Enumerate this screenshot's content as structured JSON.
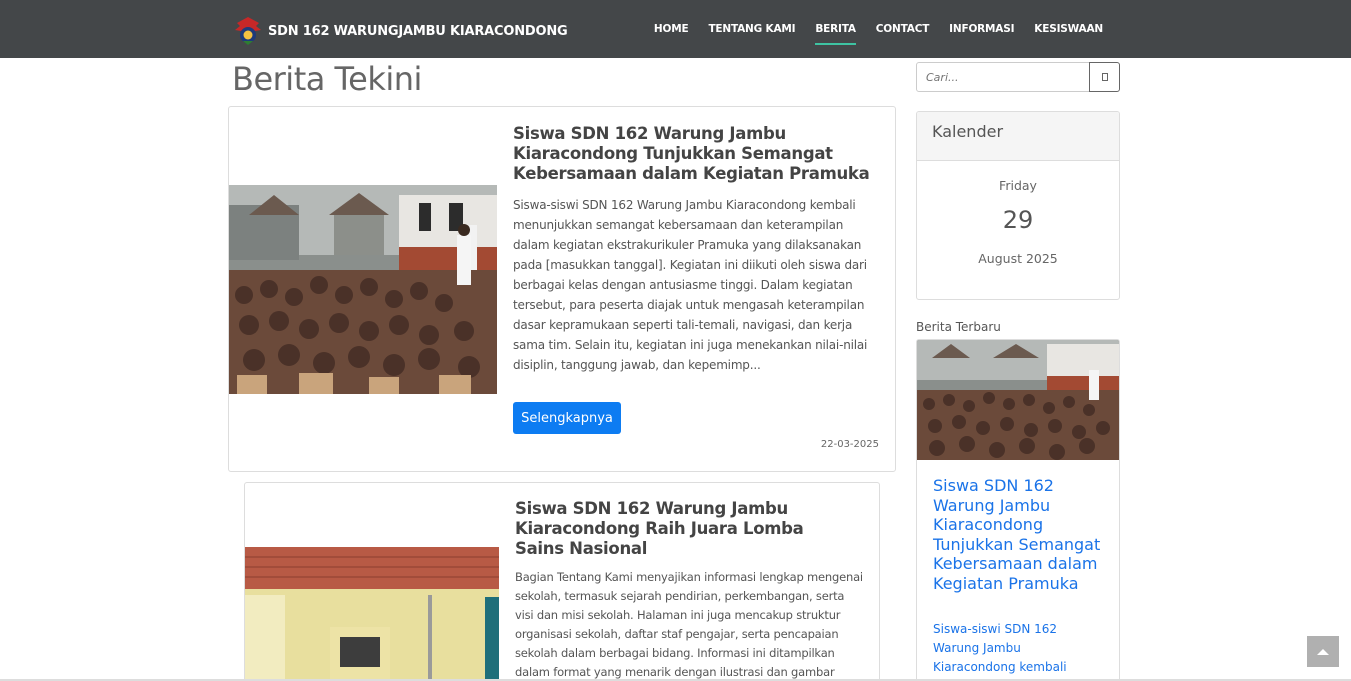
{
  "navbar": {
    "brand": "SDN 162 WARUNGJAMBU KIARACONDONG",
    "items": [
      {
        "label": "HOME",
        "active": false
      },
      {
        "label": "TENTANG KAMI",
        "active": false
      },
      {
        "label": "BERITA",
        "active": true
      },
      {
        "label": "CONTACT",
        "active": false
      },
      {
        "label": "INFORMASI",
        "active": false
      },
      {
        "label": "KESISWAAN",
        "active": false
      }
    ],
    "accent_color": "#3ec3a2"
  },
  "page": {
    "title": "Berita Tekini"
  },
  "articles": [
    {
      "title": "Siswa SDN 162 Warung Jambu Kiaracondong Tunjukkan Semangat Kebersamaan dalam Kegiatan Pramuka",
      "excerpt": "Siswa-siswi SDN 162 Warung Jambu Kiaracondong kembali menunjukkan semangat kebersamaan dan keterampilan dalam kegiatan ekstrakurikuler Pramuka yang dilaksanakan pada [masukkan tanggal]. Kegiatan ini diikuti oleh siswa dari berbagai kelas dengan antusiasme tinggi. Dalam kegiatan tersebut, para peserta diajak untuk mengasah keterampilan dasar kepramukaan seperti tali-temali, navigasi, dan kerja sama tim. Selain itu, kegiatan ini juga menekankan nilai-nilai disiplin, tanggung jawab, dan kepemimp...",
      "button": "Selengkapnya",
      "date": "22-03-2025"
    },
    {
      "title": "Siswa SDN 162 Warung Jambu Kiaracondong Raih Juara Lomba Sains Nasional",
      "excerpt": "Bagian Tentang Kami menyajikan informasi lengkap mengenai sekolah, termasuk sejarah pendirian, perkembangan, serta visi dan misi sekolah. Halaman ini juga mencakup struktur organisasi sekolah, daftar staf pengajar, serta pencapaian sekolah dalam berbagai bidang. Informasi ini ditampilkan dalam format yang menarik dengan ilustrasi dan gambar"
    }
  ],
  "sidebar": {
    "search_placeholder": "Cari...",
    "calendar": {
      "heading": "Kalender",
      "day": "Friday",
      "date": "29",
      "month_year": "August 2025"
    },
    "recent": {
      "label": "Berita Terbaru",
      "title": "Siswa SDN 162 Warung Jambu Kiaracondong Tunjukkan Semangat Kebersamaan dalam Kegiatan Pramuka",
      "excerpt": "Siswa-siswi SDN 162 Warung Jambu Kiaracondong kembali"
    }
  },
  "colors": {
    "navbar_bg": "#444749",
    "button_blue": "#0d7cf2",
    "link_blue": "#1a73e8"
  }
}
